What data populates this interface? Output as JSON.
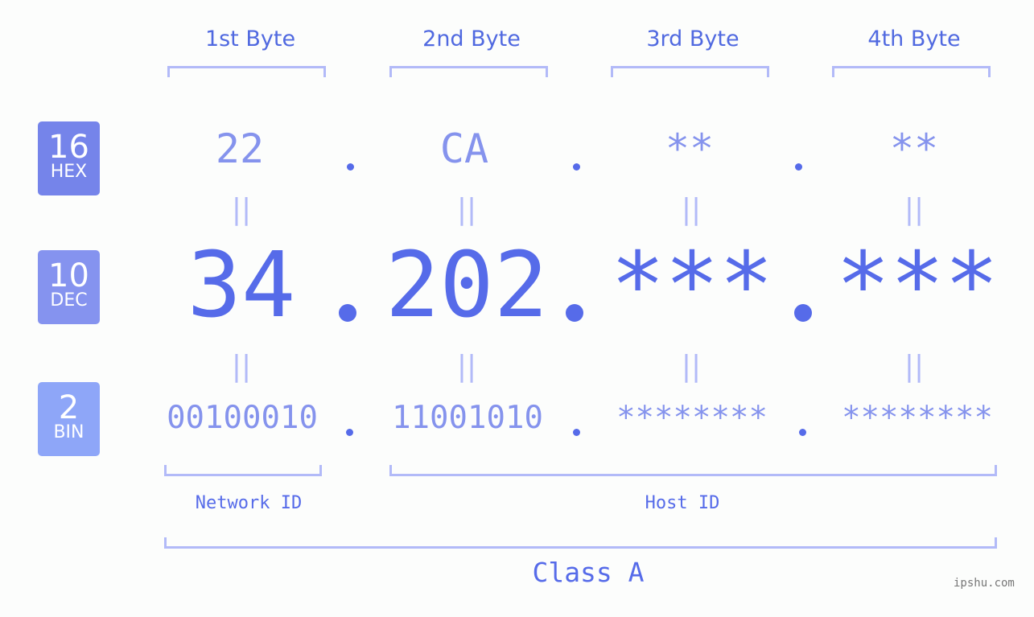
{
  "bytes": [
    {
      "label": "1st Byte",
      "hex": "22",
      "dec": "34",
      "bin": "00100010"
    },
    {
      "label": "2nd Byte",
      "hex": "CA",
      "dec": "202",
      "bin": "11001010"
    },
    {
      "label": "3rd Byte",
      "hex": "**",
      "dec": "***",
      "bin": "********"
    },
    {
      "label": "4th Byte",
      "hex": "**",
      "dec": "***",
      "bin": "********"
    }
  ],
  "badges": {
    "hex": {
      "num": "16",
      "unit": "HEX",
      "color": "#7584ea"
    },
    "dec": {
      "num": "10",
      "unit": "DEC",
      "color": "#8593ef"
    },
    "bin": {
      "num": "2",
      "unit": "BIN",
      "color": "#8ea6f8"
    }
  },
  "equals_symbol": "||",
  "network_id_label": "Network ID",
  "host_id_label": "Host ID",
  "class_label": "Class A",
  "watermark": "ipshu.com"
}
